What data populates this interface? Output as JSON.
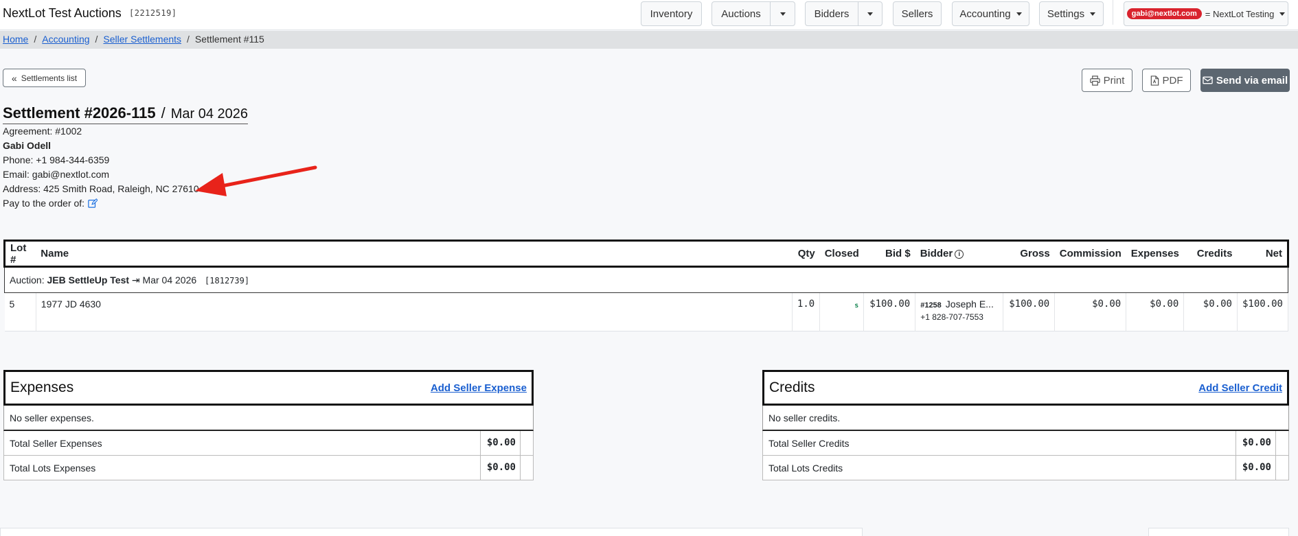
{
  "nav": {
    "brand": "NextLot Test Auctions",
    "brand_id": "[2212519]",
    "inventory": "Inventory",
    "auctions": "Auctions",
    "bidders": "Bidders",
    "sellers": "Sellers",
    "accounting": "Accounting",
    "settings": "Settings",
    "user_email": "gabi@nextlot.com",
    "user_org": "= NextLot Testing"
  },
  "breadcrumb": {
    "home": "Home",
    "accounting": "Accounting",
    "seller_settlements": "Seller Settlements",
    "current": "Settlement #115",
    "sep": "/"
  },
  "actions": {
    "back_label": "Settlements list",
    "print": "Print",
    "pdf": "PDF",
    "send_email": "Send via email"
  },
  "settlement": {
    "number": "Settlement #2026-115",
    "slash": "/",
    "date": "Mar 04 2026",
    "agreement": "Agreement: #1002",
    "seller_name": "Gabi Odell",
    "phone": "Phone: +1 984-344-6359",
    "email": "Email: gabi@nextlot.com",
    "address": "Address: 425 Smith Road, Raleigh, NC 27610",
    "pay_to": "Pay to the order of:"
  },
  "lots_table": {
    "headers": {
      "lot": "Lot #",
      "name": "Name",
      "qty": "Qty",
      "closed": "Closed",
      "bid": "Bid $",
      "bidder": "Bidder",
      "gross": "Gross",
      "commission": "Commission",
      "expenses": "Expenses",
      "credits": "Credits",
      "net": "Net"
    },
    "auction": {
      "prefix": "Auction:",
      "name": "JEB SettleUp Test",
      "arrow": "⇥",
      "date": "Mar 04 2026",
      "id": "[1812739]"
    },
    "rows": [
      {
        "lot": "5",
        "name": "1977 JD 4630",
        "qty": "1.0",
        "closed": "s",
        "bid": "$100.00",
        "bidder_num": "#1258",
        "bidder_name": "Joseph E...",
        "bidder_phone": "+1 828-707-7553",
        "gross": "$100.00",
        "commission": "$0.00",
        "expenses": "$0.00",
        "credits": "$0.00",
        "net": "$100.00"
      }
    ]
  },
  "expenses_panel": {
    "title": "Expenses",
    "add_link": "Add Seller Expense",
    "empty": "No seller expenses.",
    "total_seller_label": "Total Seller Expenses",
    "total_seller_value": "$0.00",
    "total_lots_label": "Total Lots Expenses",
    "total_lots_value": "$0.00"
  },
  "credits_panel": {
    "title": "Credits",
    "add_link": "Add Seller Credit",
    "empty": "No seller credits.",
    "total_seller_label": "Total Seller Credits",
    "total_seller_value": "$0.00",
    "total_lots_label": "Total Lots Credits",
    "total_lots_value": "$0.00"
  },
  "colors": {
    "accent_link": "#1a5fd0",
    "user_chip": "#d9232e",
    "annotation_arrow": "#e8231a",
    "dark_button": "#5c6670"
  }
}
